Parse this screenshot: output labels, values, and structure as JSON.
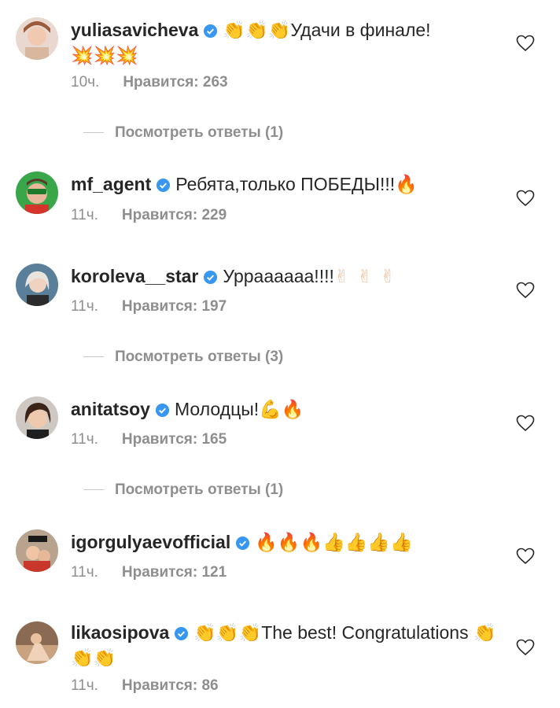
{
  "comments": [
    {
      "username": "yuliasavicheva",
      "emoji_before": "👏👏👏",
      "text": "Удачи в финале!",
      "emoji_after": "💥💥💥",
      "time": "10ч.",
      "likes": "Нравится: 263",
      "replies": "Посмотреть ответы (1)"
    },
    {
      "username": "mf_agent",
      "emoji_before": "",
      "text": "Ребята,только ПОБЕДЫ!!!",
      "emoji_after": "🔥",
      "time": "11ч.",
      "likes": "Нравится: 229",
      "replies": ""
    },
    {
      "username": "koroleva__star",
      "emoji_before": "",
      "text": "Урраааааа!!!!",
      "emoji_after": "✌✌✌",
      "time": "11ч.",
      "likes": "Нравится: 197",
      "replies": "Посмотреть ответы (3)"
    },
    {
      "username": "anitatsoy",
      "emoji_before": "",
      "text": "Молодцы!",
      "emoji_after": "💪🔥",
      "time": "11ч.",
      "likes": "Нравится: 165",
      "replies": "Посмотреть ответы (1)"
    },
    {
      "username": "igorgulyaevofficial",
      "emoji_before": "",
      "text": "",
      "emoji_after": "🔥🔥🔥👍👍👍👍",
      "time": "11ч.",
      "likes": "Нравится: 121",
      "replies": ""
    },
    {
      "username": "likaosipova",
      "emoji_before": "👏👏👏",
      "text": "The best! Congratulations",
      "emoji_after": "👏👏👏",
      "time": "11ч.",
      "likes": "Нравится: 86",
      "replies": ""
    }
  ],
  "colors": {
    "text": "#262626",
    "secondary": "#8e8e8e",
    "verified": "#3897f0"
  },
  "icons": [
    "verified-badge-icon",
    "heart-icon"
  ]
}
